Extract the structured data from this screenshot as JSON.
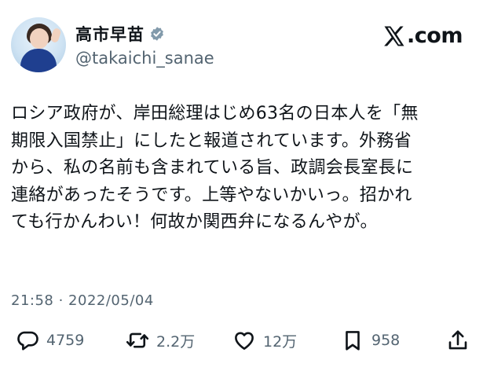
{
  "profile": {
    "name": "高市早苗",
    "handle": "@takaichi_sanae",
    "site": ".com"
  },
  "tweet": {
    "lines": [
      "ロシア政府が、岸田総理はじめ63名の日本人を「無",
      "期限入国禁止」にしたと報道されています。外務省",
      "から、私の名前も含まれている旨、政調会長室長に",
      "連絡があったそうです。上等やないかいっ。招かれ",
      "ても行かんわい！何故か関西弁になるんやが。"
    ],
    "timestamp": "21:58 · 2022/05/04"
  },
  "actions": {
    "reply_count": "4759",
    "retweet_count": "2.2万",
    "like_count": "12万",
    "bookmark_count": "958"
  },
  "icons": {
    "verified": "verified-badge-icon",
    "brand": "x-logo-icon",
    "reply": "reply-icon",
    "retweet": "retweet-icon",
    "like": "heart-icon",
    "bookmark": "bookmark-icon",
    "share": "share-icon"
  },
  "colors": {
    "text": "#0f1419",
    "secondary": "#536471",
    "verified": "#829aab"
  }
}
